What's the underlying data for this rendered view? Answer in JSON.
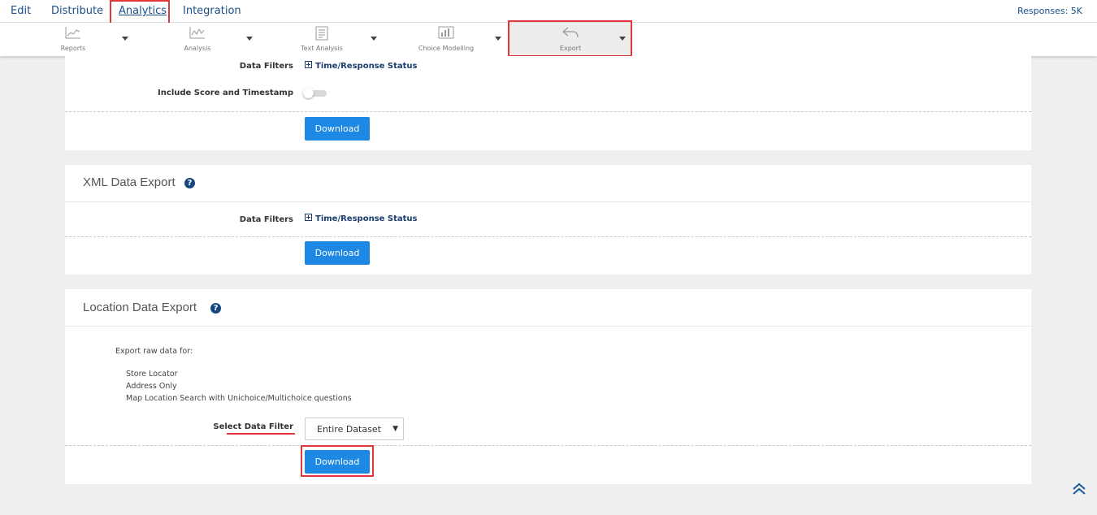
{
  "nav": {
    "tabs": [
      {
        "label": "Edit"
      },
      {
        "label": "Distribute"
      },
      {
        "label": "Analytics"
      },
      {
        "label": "Integration"
      }
    ],
    "responses": "Responses: 5K"
  },
  "toolbar": {
    "items": [
      {
        "label": "Reports",
        "icon": "reports-line-chart-icon"
      },
      {
        "label": "Analysis",
        "icon": "analysis-chart-icon"
      },
      {
        "label": "Text Analysis",
        "icon": "text-analysis-icon"
      },
      {
        "label": "Choice Modelling",
        "icon": "choice-modelling-icon"
      },
      {
        "label": "Export",
        "icon": "export-reply-arrow-icon"
      }
    ]
  },
  "section1": {
    "data_filters_label": "Data Filters",
    "filter_link": "Time/Response Status",
    "include_label": "Include Score and Timestamp",
    "download": "Download"
  },
  "xml": {
    "title": "XML Data Export",
    "help": "?",
    "data_filters_label": "Data Filters",
    "filter_link": "Time/Response Status",
    "download": "Download"
  },
  "location": {
    "title": "Location Data Export",
    "help": "?",
    "intro": "Export raw data for:",
    "items": [
      "Store Locator",
      "Address Only",
      "Map Location Search with Unichoice/Multichoice questions"
    ],
    "select_label": "Select Data Filter",
    "select_value": "Entire Dataset",
    "download": "Download"
  },
  "colors": {
    "accent": "#1e88e5",
    "highlight": "#e0373b",
    "link": "#1a4f8a"
  }
}
